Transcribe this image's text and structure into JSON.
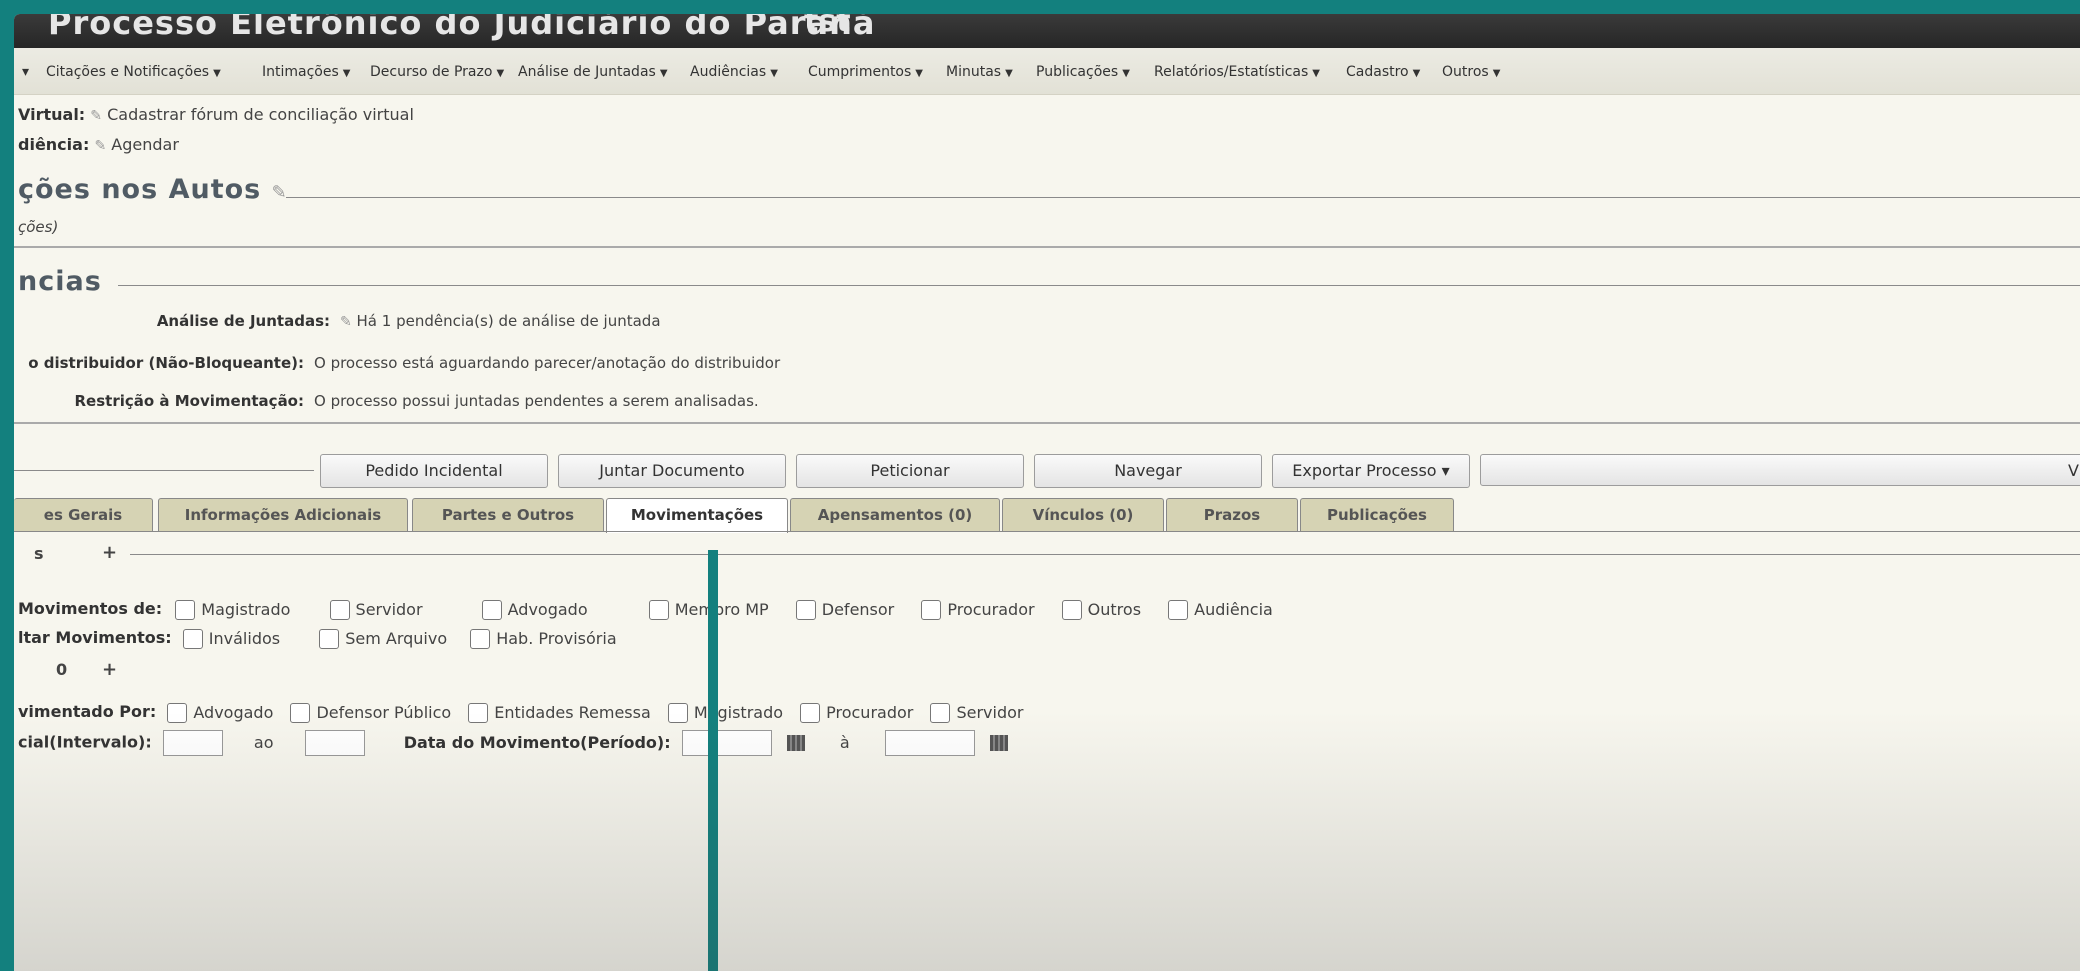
{
  "header": {
    "app_title": "Processo Eletrônico do Judiciário do Paraná",
    "env": "tst"
  },
  "menu": [
    "Citações e Notificações",
    "Intimações",
    "Decurso de Prazo",
    "Análise de Juntadas",
    "Audiências",
    "Cumprimentos",
    "Minutas",
    "Publicações",
    "Relatórios/Estatísticas",
    "Cadastro",
    "Outros"
  ],
  "info": {
    "forum_label": "Virtual:",
    "forum_value": "Cadastrar fórum de conciliação virtual",
    "audiencia_label": "diência:",
    "audiencia_value": "Agendar"
  },
  "sections": {
    "anotacoes_title": "ções nos Autos",
    "anotacoes_sub": "ções)",
    "pendencias_title": "ncias"
  },
  "pendencias": [
    {
      "label": "Análise de Juntadas:",
      "value": "Há 1 pendência(s) de análise de juntada"
    },
    {
      "label": "o distribuidor (Não-Bloqueante):",
      "value": "O processo está aguardando parecer/anotação do distribuidor"
    },
    {
      "label": "Restrição à Movimentação:",
      "value": "O processo possui juntadas pendentes a serem analisadas."
    }
  ],
  "buttons": [
    "Pedido Incidental",
    "Juntar Documento",
    "Peticionar",
    "Navegar",
    "Exportar Processo ▾",
    "V"
  ],
  "tabs": [
    "es Gerais",
    "Informações Adicionais",
    "Partes e Outros",
    "Movimentações",
    "Apensamentos (0)",
    "Vínculos (0)",
    "Prazos",
    "Publicações"
  ],
  "filters": {
    "group1_title": "s",
    "group1_icon": "+",
    "mov_de_label": "Movimentos de:",
    "mov_de_options": [
      "Magistrado",
      "Servidor",
      "Advogado",
      "Membro MP",
      "Defensor",
      "Procurador",
      "Outros",
      "Audiência"
    ],
    "ocultar_label": "ltar Movimentos:",
    "ocultar_options": [
      "Inválidos",
      "Sem Arquivo",
      "Hab. Provisória"
    ],
    "group2_title": "0",
    "group2_icon": "+",
    "mov_por_label": "vimentado Por:",
    "mov_por_options": [
      "Advogado",
      "Defensor Público",
      "Entidades Remessa",
      "Magistrado",
      "Procurador",
      "Servidor"
    ],
    "intervalo_label": "cial(Intervalo):",
    "ao": "ao",
    "data_label": "Data do Movimento(Período):",
    "a": "à"
  }
}
